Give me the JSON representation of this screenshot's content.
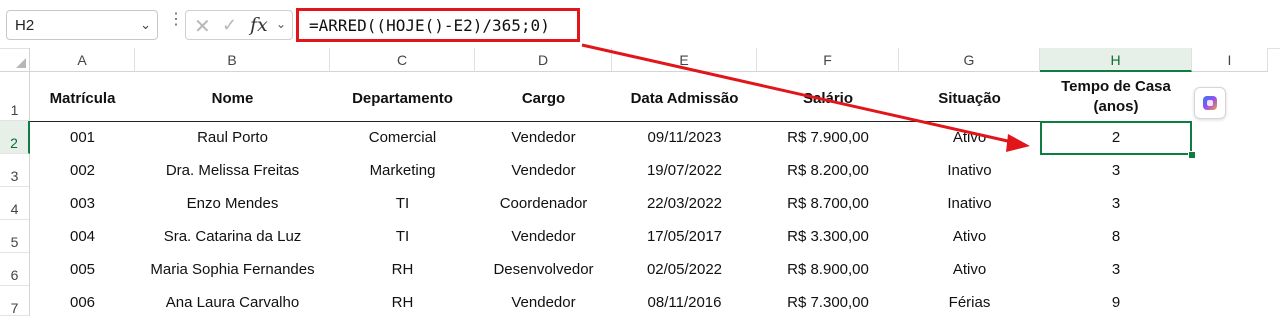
{
  "name_box": {
    "value": "H2"
  },
  "formula_bar": {
    "formula": "=ARRED((HOJE()-E2)/365;0)"
  },
  "icons": {
    "cancel": "cancel-x-icon",
    "enter": "enter-check-icon",
    "function": "insert-function-icon",
    "copilot": "copilot-icon"
  },
  "colors": {
    "accent": "#107c41",
    "highlight": "#e0161b"
  },
  "columns": [
    "A",
    "B",
    "C",
    "D",
    "E",
    "F",
    "G",
    "H",
    "I"
  ],
  "rows": [
    "1",
    "2",
    "3",
    "4",
    "5",
    "6",
    "7"
  ],
  "headers": {
    "matricula": "Matrícula",
    "nome": "Nome",
    "departamento": "Departamento",
    "cargo": "Cargo",
    "data_admissao": "Data Admissão",
    "salario": "Salário",
    "situacao": "Situação",
    "tempo_line1": "Tempo de Casa",
    "tempo_line2": "(anos)"
  },
  "table": [
    [
      "001",
      "Raul Porto",
      "Comercial",
      "Vendedor",
      "09/11/2023",
      "R$ 7.900,00",
      "Ativo",
      "2"
    ],
    [
      "002",
      "Dra. Melissa Freitas",
      "Marketing",
      "Vendedor",
      "19/07/2022",
      "R$ 8.200,00",
      "Inativo",
      "3"
    ],
    [
      "003",
      "Enzo Mendes",
      "TI",
      "Coordenador",
      "22/03/2022",
      "R$ 8.700,00",
      "Inativo",
      "3"
    ],
    [
      "004",
      "Sra. Catarina da Luz",
      "TI",
      "Vendedor",
      "17/05/2017",
      "R$ 3.300,00",
      "Ativo",
      "8"
    ],
    [
      "005",
      "Maria Sophia Fernandes",
      "RH",
      "Desenvolvedor",
      "02/05/2022",
      "R$ 8.900,00",
      "Ativo",
      "3"
    ],
    [
      "006",
      "Ana Laura Carvalho",
      "RH",
      "Vendedor",
      "08/11/2016",
      "R$ 7.300,00",
      "Férias",
      "9"
    ]
  ]
}
